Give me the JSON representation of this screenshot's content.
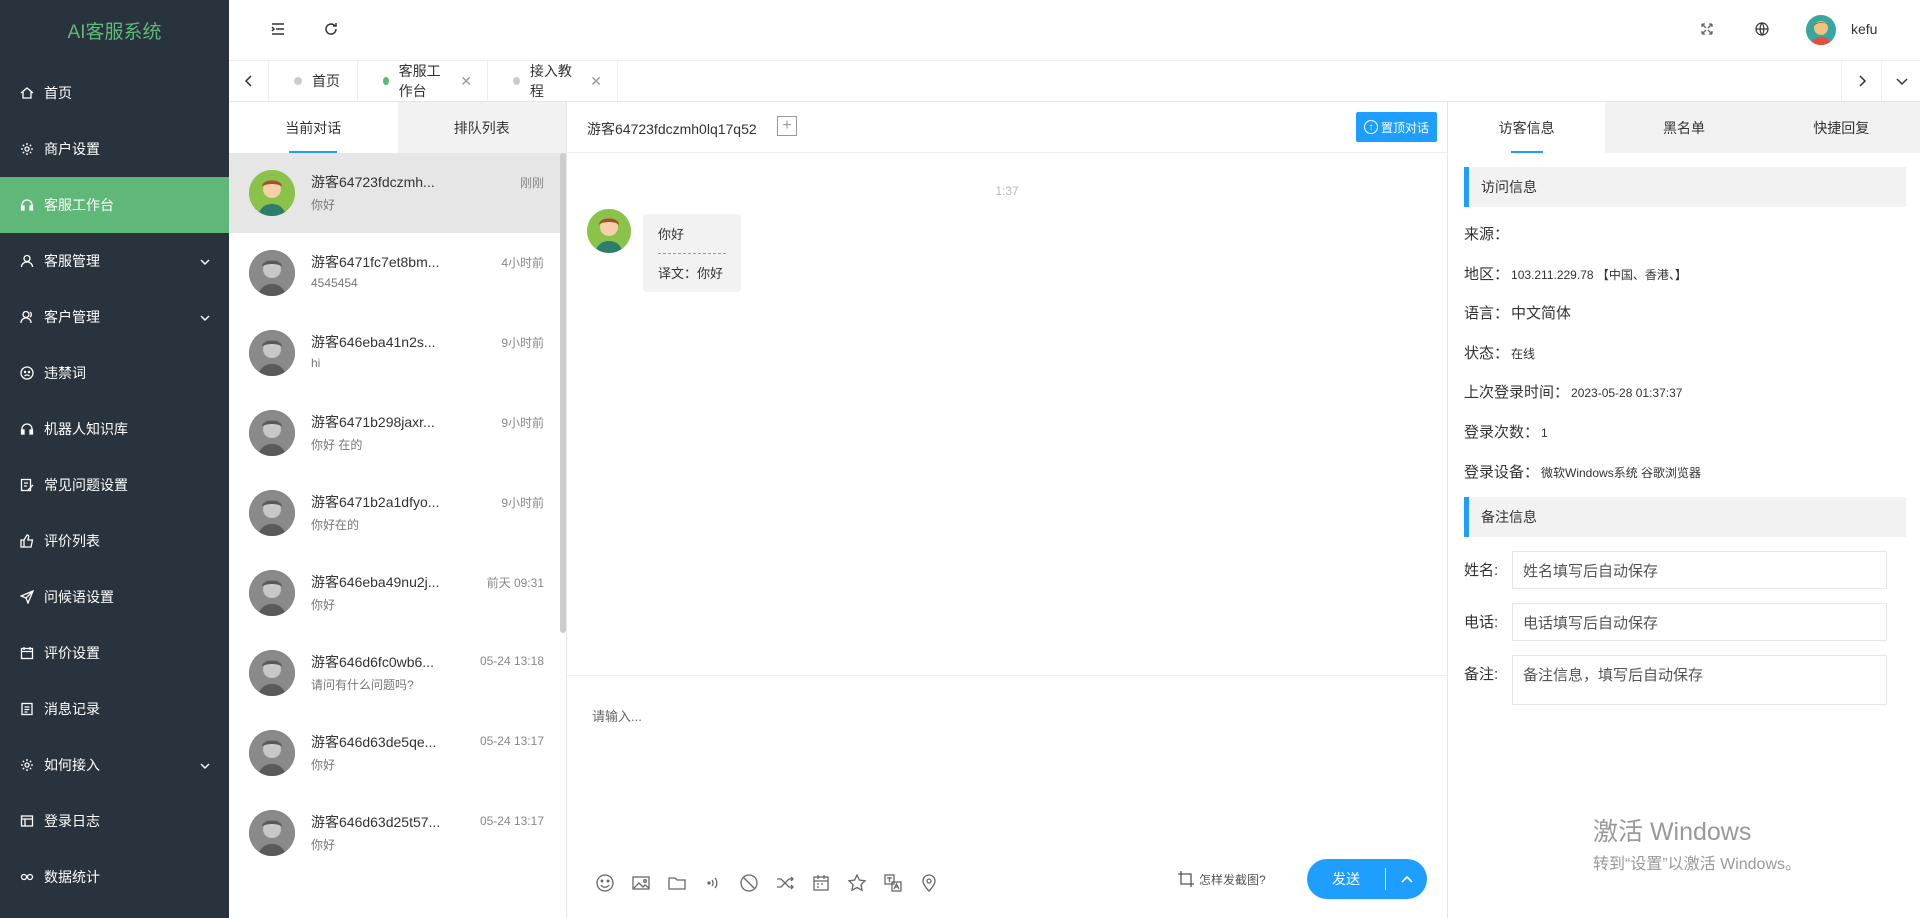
{
  "app": {
    "logo": "AI客服系统"
  },
  "sidebar": {
    "items": [
      {
        "label": "首页",
        "icon": "home-icon",
        "active": false,
        "expandable": false
      },
      {
        "label": "商户设置",
        "icon": "gear-icon",
        "active": false,
        "expandable": false
      },
      {
        "label": "客服工作台",
        "icon": "headset-icon",
        "active": true,
        "expandable": false
      },
      {
        "label": "客服管理",
        "icon": "user-icon",
        "active": false,
        "expandable": true
      },
      {
        "label": "客户管理",
        "icon": "users-icon",
        "active": false,
        "expandable": true
      },
      {
        "label": "违禁词",
        "icon": "face-icon",
        "active": false,
        "expandable": false
      },
      {
        "label": "机器人知识库",
        "icon": "headset-icon",
        "active": false,
        "expandable": false
      },
      {
        "label": "常见问题设置",
        "icon": "edit-icon",
        "active": false,
        "expandable": false
      },
      {
        "label": "评价列表",
        "icon": "thumb-icon",
        "active": false,
        "expandable": false
      },
      {
        "label": "问候语设置",
        "icon": "send-icon",
        "active": false,
        "expandable": false
      },
      {
        "label": "评价设置",
        "icon": "calendar-icon",
        "active": false,
        "expandable": false
      },
      {
        "label": "消息记录",
        "icon": "doc-icon",
        "active": false,
        "expandable": false
      },
      {
        "label": "如何接入",
        "icon": "gear-icon",
        "active": false,
        "expandable": true
      },
      {
        "label": "登录日志",
        "icon": "table-icon",
        "active": false,
        "expandable": false
      },
      {
        "label": "数据统计",
        "icon": "link-icon",
        "active": false,
        "expandable": false
      }
    ]
  },
  "header": {
    "username": "kefu"
  },
  "tabs": [
    {
      "label": "首页",
      "active": false,
      "closable": false
    },
    {
      "label": "客服工作台",
      "active": true,
      "closable": true
    },
    {
      "label": "接入教程",
      "active": false,
      "closable": true
    }
  ],
  "conversations": {
    "tab_current": "当前对话",
    "tab_queue": "排队列表",
    "items": [
      {
        "name": "游客64723fdczmh...",
        "time": "刚刚",
        "message": "你好",
        "selected": true
      },
      {
        "name": "游客6471fc7et8bm...",
        "time": "4小时前",
        "message": "4545454",
        "selected": false
      },
      {
        "name": "游客646eba41n2s...",
        "time": "9小时前",
        "message": "hi",
        "selected": false
      },
      {
        "name": "游客6471b298jaxr...",
        "time": "9小时前",
        "message": "你好 在的",
        "selected": false
      },
      {
        "name": "游客6471b2a1dfyo...",
        "time": "9小时前",
        "message": "你好在的",
        "selected": false
      },
      {
        "name": "游客646eba49nu2j...",
        "time": "前天 09:31",
        "message": "你好",
        "selected": false
      },
      {
        "name": "游客646d6fc0wb6...",
        "time": "05-24 13:18",
        "message": "请问有什么问题吗?",
        "selected": false
      },
      {
        "name": "游客646d63de5qe...",
        "time": "05-24 13:17",
        "message": "你好",
        "selected": false
      },
      {
        "name": "游客646d63d25t57...",
        "time": "05-24 13:17",
        "message": "你好",
        "selected": false
      }
    ]
  },
  "chat": {
    "title": "游客64723fdczmh0lq17q52",
    "add_symbol": "+",
    "pin_button": "置顶对话",
    "pin_icon_char": "↑",
    "time": "1:37",
    "message": {
      "text": "你好",
      "translation": "译文：你好"
    },
    "input_placeholder": "请输入...",
    "screenshot_help": "怎样发截图?",
    "send_label": "发送",
    "tools": [
      "smile-icon",
      "image-icon",
      "folder-icon",
      "voice-icon",
      "block-icon",
      "shuffle-icon",
      "calendar-icon",
      "star-icon",
      "translate-icon",
      "location-icon"
    ]
  },
  "info": {
    "tabs": [
      "访客信息",
      "黑名单",
      "快捷回复"
    ],
    "visit_section": "访问信息",
    "rows": [
      {
        "label": "来源：",
        "value": ""
      },
      {
        "label": "地区：",
        "value": "103.211.229.78 【中国、香港、】"
      },
      {
        "label": "语言：",
        "value": "中文简体"
      },
      {
        "label": "状态：",
        "value": "在线"
      },
      {
        "label": "上次登录时间：",
        "value": "2023-05-28 01:37:37"
      },
      {
        "label": "登录次数：",
        "value": "1"
      },
      {
        "label": "登录设备：",
        "value": "微软Windows系统 谷歌浏览器"
      }
    ],
    "note_section": "备注信息",
    "form": {
      "name_label": "姓名:",
      "name_placeholder": "姓名填写后自动保存",
      "phone_label": "电话:",
      "phone_placeholder": "电话填写后自动保存",
      "note_label": "备注:",
      "note_placeholder": "备注信息，填写后自动保存"
    }
  },
  "watermark": {
    "line1": "激活 Windows",
    "line2": "转到“设置”以激活 Windows。"
  },
  "colors": {
    "sidebar_bg": "#28333e",
    "accent_green": "#5fb878",
    "accent_blue": "#1e9fff"
  }
}
